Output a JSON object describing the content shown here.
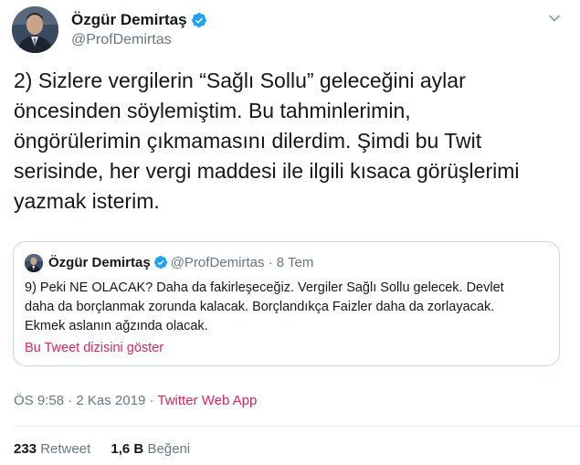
{
  "author": {
    "name": "Özgür Demirtaş",
    "handle": "@ProfDemirtas",
    "verified": true
  },
  "tweet": {
    "text": "2) Sizlere vergilerin “Sağlı Sollu” geleceğini aylar\nöncesinden söylemiştim. Bu tahminlerimin,\nöngörülerimin çıkmamasını dilerdim. Şimdi bu Twit\nserisinde, her vergi maddesi ile ilgili kısaca görüşlerimi\nyazmak isterim."
  },
  "quoted_tweet": {
    "name": "Özgür Demirtaş",
    "handle": "@ProfDemirtas",
    "separator": "·",
    "date": "8 Tem",
    "text": "9) Peki NE OLACAK? Daha da fakirleşeceğiz. Vergiler Sağlı Sollu gelecek. Devlet\ndaha da borçlanmak zorunda kalacak. Borçlandıkça Faizler daha da zorlayacak.\nEkmek aslanın ağzında olacak.",
    "show_thread": "Bu Tweet dizisini göster"
  },
  "meta": {
    "time": "ÖS 9:58",
    "sep1": "·",
    "date": "2 Kas 2019",
    "sep2": "·",
    "app": "Twitter Web App"
  },
  "stats": {
    "retweets_count": "233",
    "retweets_label": "Retweet",
    "likes_count": "1,6 B",
    "likes_label": "Beğeni"
  },
  "colors": {
    "accent": "#e0245e",
    "verified": "#1da1f2",
    "secondary_text": "#657786",
    "border": "#ccd6dd"
  },
  "icons": {
    "verified": "verified-badge-icon",
    "menu": "chevron-down-icon"
  }
}
